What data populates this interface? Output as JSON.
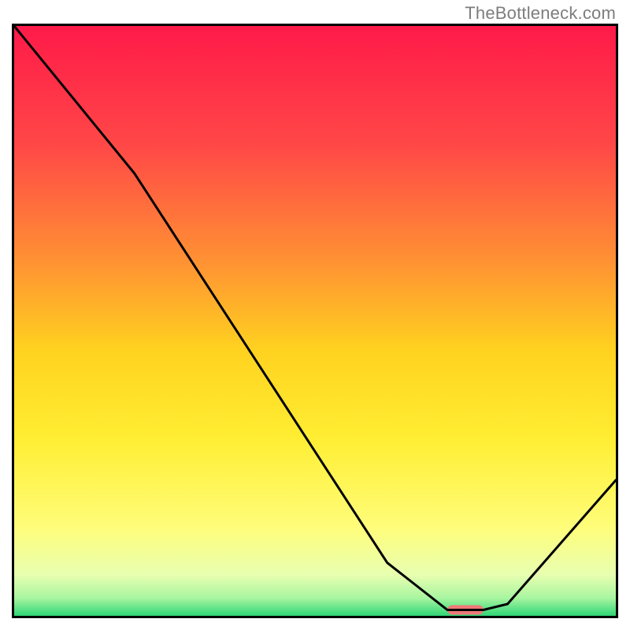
{
  "watermark": "TheBottleneck.com",
  "chart_data": {
    "type": "line",
    "title": "",
    "xlabel": "",
    "ylabel": "",
    "xlim": [
      0,
      100
    ],
    "ylim": [
      0,
      100
    ],
    "grid": false,
    "series": [
      {
        "name": "bottleneck-curve",
        "x": [
          0,
          20,
          62,
          72,
          78,
          82,
          100
        ],
        "values": [
          100,
          75,
          9,
          1,
          1,
          2,
          23
        ]
      }
    ],
    "annotations": [
      {
        "name": "optimal-marker",
        "x_start": 72,
        "x_end": 78,
        "y": 1,
        "color": "#f07878"
      }
    ],
    "background_gradient": {
      "stops": [
        {
          "offset": 0.0,
          "color": "#ff1a49"
        },
        {
          "offset": 0.2,
          "color": "#ff4747"
        },
        {
          "offset": 0.4,
          "color": "#ff9233"
        },
        {
          "offset": 0.55,
          "color": "#ffd21f"
        },
        {
          "offset": 0.7,
          "color": "#ffee33"
        },
        {
          "offset": 0.85,
          "color": "#fffd7a"
        },
        {
          "offset": 0.93,
          "color": "#e8ffb0"
        },
        {
          "offset": 0.97,
          "color": "#a8f5a0"
        },
        {
          "offset": 1.0,
          "color": "#2fd676"
        }
      ]
    }
  }
}
